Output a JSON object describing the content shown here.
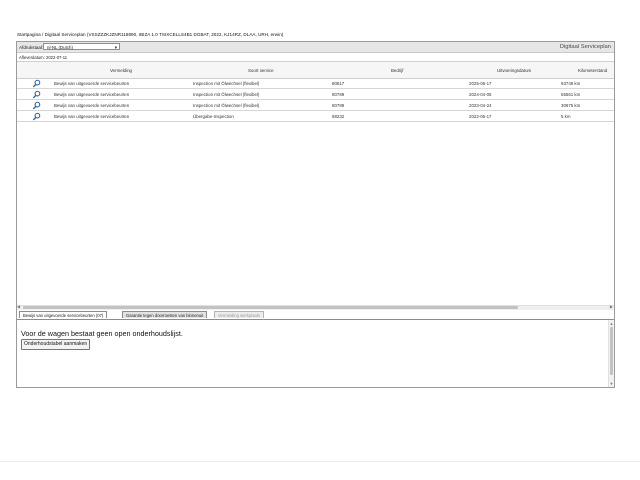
{
  "breadcrumb": "Startpagina / Digitaal Serviceplan (VSSZZZKJZNR118890, IBIZA 1.0 TSIXCELLS4B1 DGBAT, 2022, KJ14RZ, DLAA, URH, erwin)",
  "toolbar": {
    "language_label": "Afdrukstaal:",
    "language_value": "nl-NL (Dutch)",
    "app_title": "Digitaal Serviceplan"
  },
  "print_date": "Afleverdatum: 2022-07-11",
  "grid": {
    "columns": [
      "Vermelding",
      "Soort service",
      "Bedrijf",
      "Uitvoeringsdatum",
      "Kilometerstand"
    ],
    "rows": [
      {
        "icon": "magnifier-icon",
        "vermelding": "Bewijs van uitgevoerde servicebeurten",
        "soort": "Inspection mit Ölwechsel (flexibel)",
        "bedrijf": "80817",
        "datum": "2025-06-17",
        "km": "93749 km"
      },
      {
        "icon": "magnifier-icon",
        "vermelding": "Bewijs van uitgevoerde servicebeurten",
        "soort": "Inspection mit Ölwechsel (flexibel)",
        "bedrijf": "80789",
        "datum": "2024-04-05",
        "km": "65561 km"
      },
      {
        "icon": "magnifier-icon",
        "vermelding": "Bewijs van uitgevoerde servicebeurten",
        "soort": "Inspection mit Ölwechsel (flexibel)",
        "bedrijf": "80789",
        "datum": "2023-04-24",
        "km": "30975 km"
      },
      {
        "icon": "magnifier-icon",
        "vermelding": "Bewijs van uitgevoerde servicebeurten",
        "soort": "Übergabe-Inspection",
        "bedrijf": "88232",
        "datum": "2022-06-17",
        "km": "5 km"
      }
    ]
  },
  "tabs": [
    {
      "label": "Bewijs van uitgevoerde servicebeurten (07)",
      "state": "active"
    },
    {
      "label": "Garantie tegen doorroesten van binnenuit",
      "state": "normal"
    },
    {
      "label": "Vermelding werkplaats",
      "state": "disabled"
    }
  ],
  "panel": {
    "message": "Voor de wagen bestaat geen open onderhoudslijst.",
    "button_label": "Onderhoudstabel aanmaken"
  },
  "colors": {
    "icon_blue": "#2b5fa8",
    "toolbar_bg": "#e6e6e6",
    "border": "#9b9b9b"
  }
}
